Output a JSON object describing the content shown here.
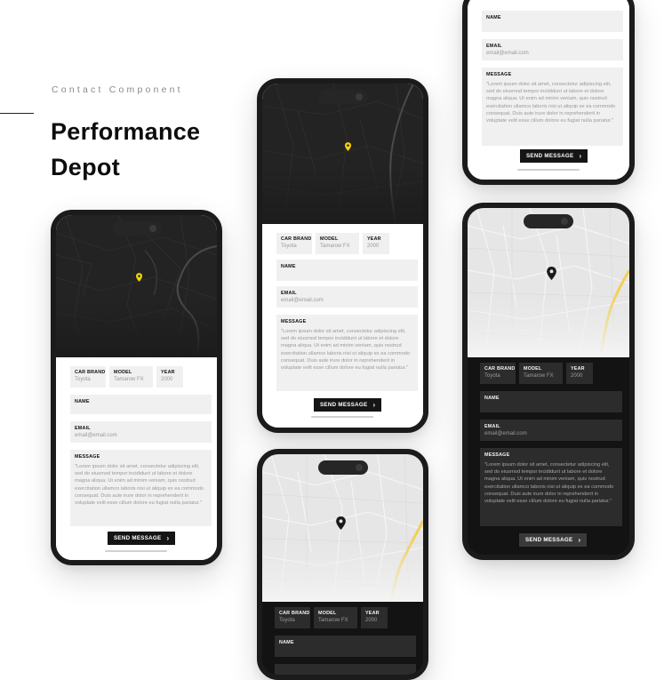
{
  "hero": {
    "eyebrow": "Contact Component",
    "title": "Performance Depot"
  },
  "form": {
    "car_brand_label": "CAR BRAND",
    "car_brand_value": "Toyota",
    "model_label": "MODEL",
    "model_value": "Tamarow FX",
    "year_label": "YEAR",
    "year_value": "2000",
    "name_label": "NAME",
    "email_label": "EMAIL",
    "email_placeholder": "email@email.com",
    "message_label": "MESSAGE",
    "message_text": "\"Lorem ipsum dolor sit amet, consectetur adipiscing elit, sed do eiusmod tempor incididunt ut labore et dolore magna aliqua. Ut enim ad minim veniam, quis nostrud exercitation ullamco laboris nisi ut aliquip ex ea commodo consequat. Duis aute irure dolor in reprehenderit in voluptate velit esse cillum dolore eu fugiat nulla pariatur.\"",
    "send_label": "SEND MESSAGE",
    "send_icon": "chevron-right-icon"
  },
  "colors": {
    "pin_yellow": "#f5d300",
    "pin_dark": "#1a1a1a",
    "road_yellow": "#f2cf55",
    "dark_map": "#1c1c1c",
    "light_map": "#e9e9e9"
  }
}
